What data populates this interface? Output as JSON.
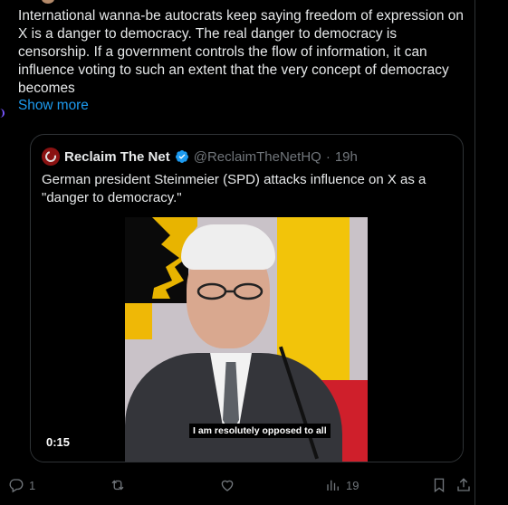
{
  "post": {
    "text": "International wanna-be autocrats keep saying freedom of expression on X is a danger to democracy. The real danger to democracy is censorship. If a government controls the flow of information, it can influence voting to such an extent that the very concept of democracy becomes",
    "show_more": "Show more"
  },
  "quote": {
    "name": "Reclaim The Net",
    "handle": "@ReclaimTheNetHQ",
    "separator": "·",
    "time": "19h",
    "text": "German president Steinmeier (SPD) attacks influence on X as a \"danger to democracy.\"",
    "video": {
      "subtitle": "I am resolutely opposed to all",
      "timecode": "0:15"
    }
  },
  "actions": {
    "replies": "1",
    "reposts": "",
    "likes": "",
    "views": "19"
  },
  "colors": {
    "background": "#000000",
    "text": "#e7e9ea",
    "muted": "#71767b",
    "link": "#1d9bf0",
    "border": "#2f3336",
    "verified": "#1d9bf0"
  }
}
